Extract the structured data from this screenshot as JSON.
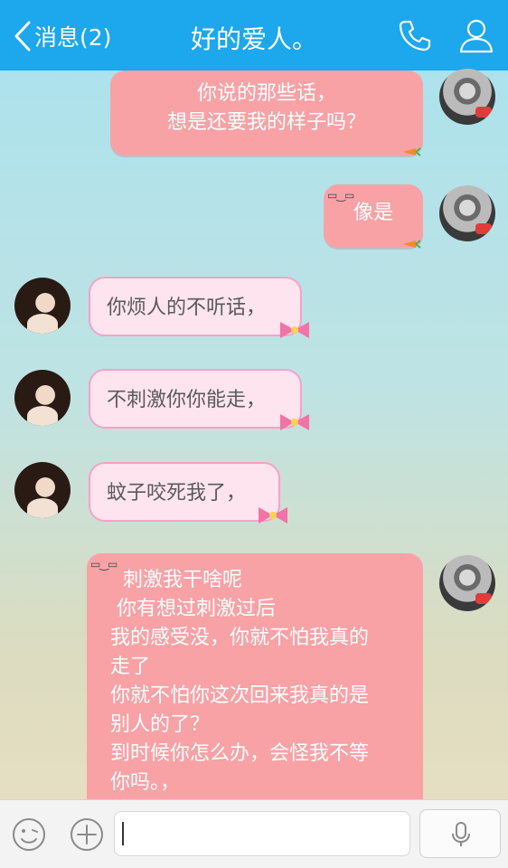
{
  "header": {
    "back_label": "消息(2)",
    "title": "好的爱人。"
  },
  "messages": [
    {
      "side": "out",
      "lines": [
        "你说的那些话，",
        "想是还要我的样子吗？"
      ]
    },
    {
      "side": "out",
      "lines": [
        "像是"
      ]
    },
    {
      "side": "in",
      "lines": [
        "你烦人的不听话，"
      ]
    },
    {
      "side": "in",
      "lines": [
        "不刺激你你能走，"
      ]
    },
    {
      "side": "in",
      "lines": [
        "蚊子咬死我了，"
      ]
    },
    {
      "side": "out",
      "lines": [
        "  刺激我干啥呢",
        " 你有想过刺激过后",
        "我的感受没，你就不怕我真的",
        "走了",
        "你就不怕你这次回来我真的是",
        "别人的了？",
        "到时候你怎么办，会怪我不等",
        "你吗。，"
      ]
    }
  ],
  "input": {
    "placeholder": ""
  },
  "icons": {
    "back": "chevron-left-icon",
    "call": "phone-icon",
    "profile": "person-icon",
    "emoji": "smiley-icon",
    "plus": "plus-circle-icon",
    "voice": "microphone-icon"
  },
  "colors": {
    "header": "#1da7ec",
    "bubble_out": "#f8a2a6",
    "bubble_in": "#fde4ef"
  }
}
